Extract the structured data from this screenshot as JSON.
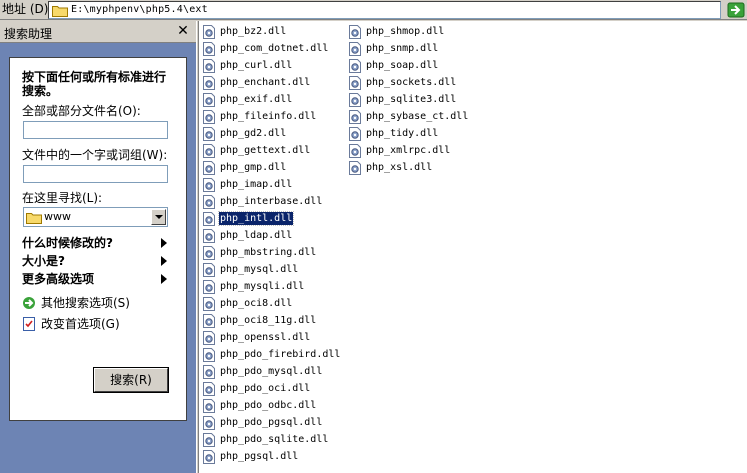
{
  "address": {
    "label": "地址 (D)",
    "path": "E:\\myphpenv\\php5.4\\ext"
  },
  "search_pane": {
    "title": "搜索助理",
    "intro": "按下面任何或所有标准进行搜索。",
    "name_label": "全部或部分文件名(O):",
    "name_value": "",
    "content_label": "文件中的一个字或词组(W):",
    "content_value": "",
    "look_in_label": "在这里寻找(L):",
    "look_in_value": "www",
    "options": [
      {
        "label": "什么时候修改的?"
      },
      {
        "label": "大小是?"
      },
      {
        "label": "更多高级选项"
      }
    ],
    "links": [
      {
        "label": "其他搜索选项(S)"
      },
      {
        "label": "改变首选项(G)"
      }
    ],
    "search_button": "搜索(R)"
  },
  "files": {
    "column1": [
      "php_bz2.dll",
      "php_com_dotnet.dll",
      "php_curl.dll",
      "php_enchant.dll",
      "php_exif.dll",
      "php_fileinfo.dll",
      "php_gd2.dll",
      "php_gettext.dll",
      "php_gmp.dll",
      "php_imap.dll",
      "php_interbase.dll",
      "php_intl.dll",
      "php_ldap.dll",
      "php_mbstring.dll",
      "php_mysql.dll",
      "php_mysqli.dll",
      "php_oci8.dll",
      "php_oci8_11g.dll",
      "php_openssl.dll",
      "php_pdo_firebird.dll",
      "php_pdo_mysql.dll",
      "php_pdo_oci.dll",
      "php_pdo_odbc.dll",
      "php_pdo_pgsql.dll",
      "php_pdo_sqlite.dll",
      "php_pgsql.dll"
    ],
    "column2": [
      "php_shmop.dll",
      "php_snmp.dll",
      "php_soap.dll",
      "php_sockets.dll",
      "php_sqlite3.dll",
      "php_sybase_ct.dll",
      "php_tidy.dll",
      "php_xmlrpc.dll",
      "php_xsl.dll"
    ],
    "selected": "php_intl.dll"
  },
  "icons": {
    "dll": "dll-file-icon",
    "folder": "folder-icon",
    "go": "go-arrow-icon"
  }
}
